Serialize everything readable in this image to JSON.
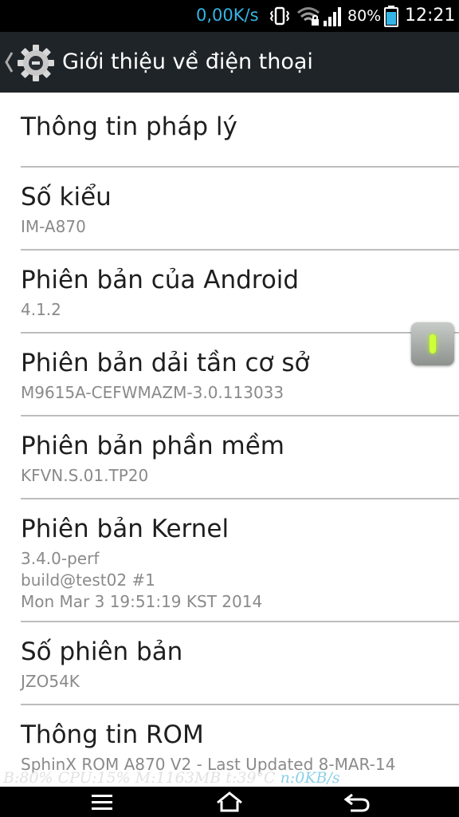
{
  "status_bar": {
    "net_speed": "0,00K/s",
    "battery_percent": "80%",
    "time": "12:21",
    "icons": [
      "vibrate-icon",
      "wifi-icon",
      "signal-icon",
      "battery-icon"
    ],
    "accent_color": "#33b5e5"
  },
  "action_bar": {
    "title": "Giới thiệu về điện thoại",
    "icons": [
      "back-chevron-icon",
      "settings-gear-icon"
    ]
  },
  "items": [
    {
      "title": "Thông tin pháp lý",
      "lines": []
    },
    {
      "title": "Số kiểu",
      "lines": [
        "IM-A870"
      ]
    },
    {
      "title": "Phiên bản của Android",
      "lines": [
        "4.1.2"
      ]
    },
    {
      "title": "Phiên bản dải tần cơ sở",
      "lines": [
        "M9615A-CEFWMAZM-3.0.113033"
      ]
    },
    {
      "title": "Phiên bản phần mềm",
      "lines": [
        "KFVN.S.01.TP20"
      ]
    },
    {
      "title": "Phiên bản Kernel",
      "lines": [
        "3.4.0-perf",
        "build@test02 #1",
        "Mon Mar 3 19:51:19 KST 2014"
      ]
    },
    {
      "title": "Số phiên bản",
      "lines": [
        "JZO54K"
      ]
    },
    {
      "title": "Thông tin ROM",
      "lines": [
        "SphinX ROM A870 V2 - Last Updated 8-MAR-14"
      ]
    }
  ],
  "overlay": {
    "stats": "B:80% CPU:15% M:1163MB t:39°C",
    "net": "n:0KB/s"
  },
  "nav_bar": {
    "icons": [
      "menu-icon",
      "home-icon",
      "back-icon"
    ]
  }
}
